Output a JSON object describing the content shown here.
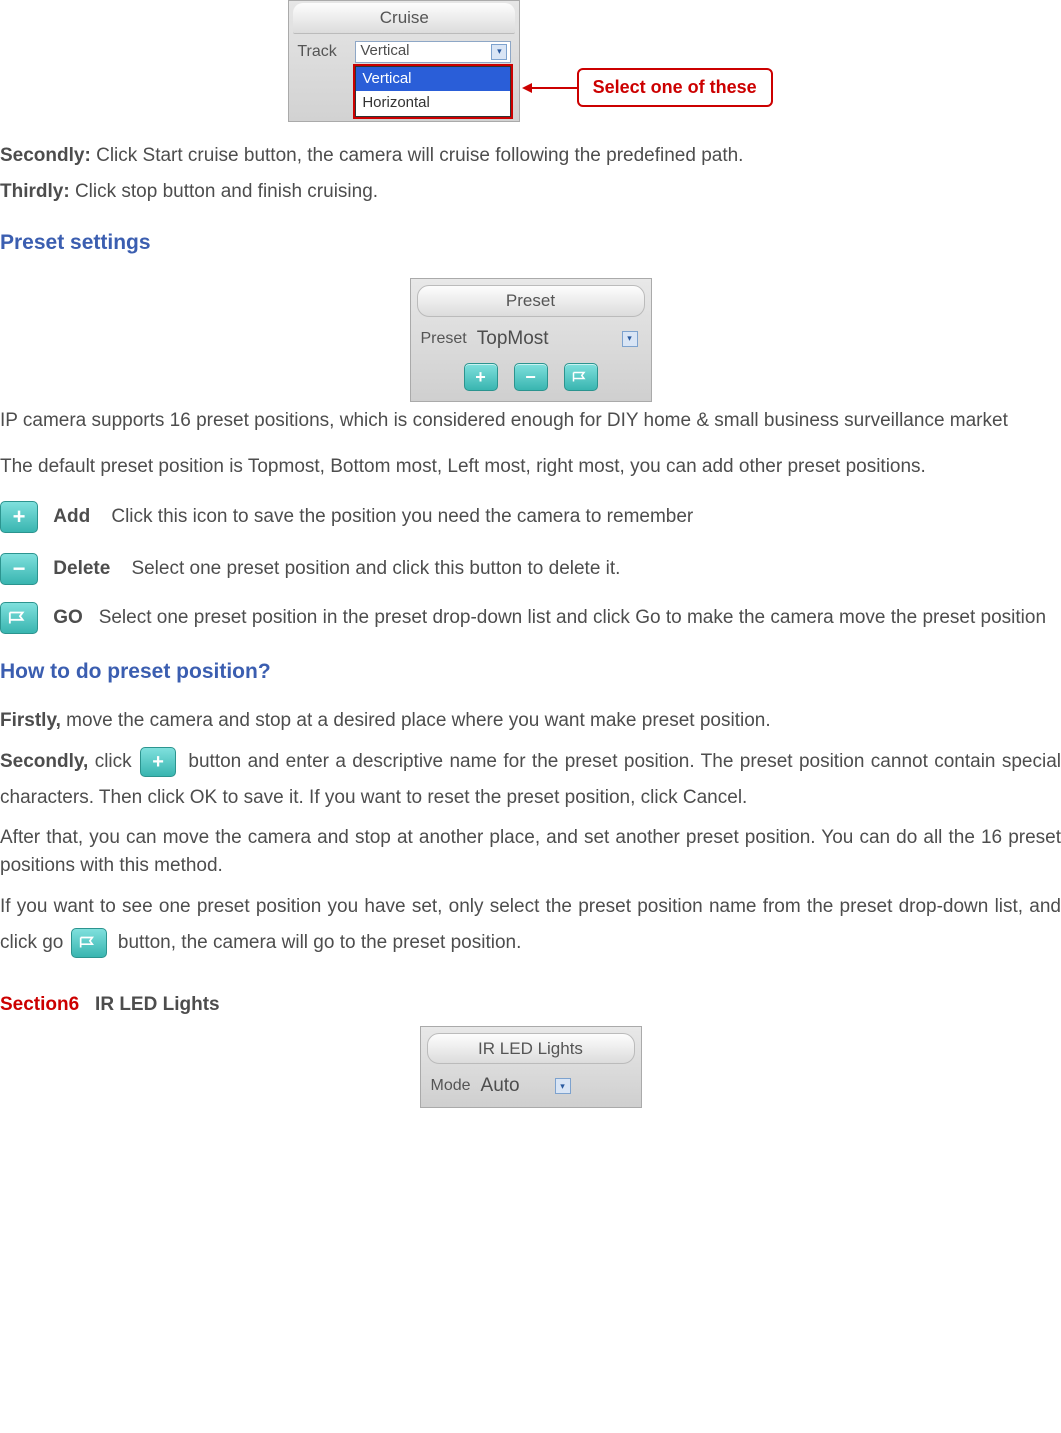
{
  "cruise_panel": {
    "title": "Cruise",
    "row_label": "Track",
    "selected": "Vertical",
    "options": [
      "Vertical",
      "Horizontal"
    ]
  },
  "callout": {
    "text": "Select one of these"
  },
  "body1": {
    "secondly_label": "Secondly:",
    "secondly_text": " Click Start cruise button, the camera will cruise following the predefined path.",
    "thirdly_label": "Thirdly:",
    "thirdly_text": " Click stop button and finish cruising."
  },
  "heading_preset": "Preset settings",
  "preset_panel": {
    "title": "Preset",
    "row_label": "Preset",
    "selected": "TopMost"
  },
  "preset_text": {
    "p1": "IP camera supports 16 preset positions, which is considered enough for DIY home & small business surveillance market",
    "p2": "The default preset position is Topmost, Bottom most, Left most, right most, you can add other preset positions."
  },
  "icon_defs": {
    "add_label": "Add",
    "add_text": "Click this icon to save the position you need the camera to remember",
    "del_label": "Delete",
    "del_text": "Select one preset position and click this button to delete it.",
    "go_label": "GO",
    "go_text": "Select one preset position in the preset drop-down list and click Go to make the camera move the preset position"
  },
  "heading_howto": "How to do preset position?",
  "howto": {
    "firstly_label": "Firstly,",
    "firstly_text": " move the camera and stop at a desired place where you want make preset position.",
    "secondly_label": "Secondly,",
    "secondly_pre": " click ",
    "secondly_post": " button and enter a descriptive name for the preset position. The preset position cannot contain special characters. Then click OK to save it. If you want to reset the preset position, click Cancel.",
    "after": "After that, you can move the camera and stop at another place, and set another preset position. You can do all the 16 preset positions with this method.",
    "ifyou_pre": "If you want to see one preset position you have set, only select the preset position name from the preset drop-down list, and click go ",
    "ifyou_post": " button, the camera will go to the preset position."
  },
  "section6": {
    "label": "Section6",
    "title": "IR LED Lights"
  },
  "ir_panel": {
    "title": "IR LED Lights",
    "row_label": "Mode",
    "selected": "Auto"
  }
}
